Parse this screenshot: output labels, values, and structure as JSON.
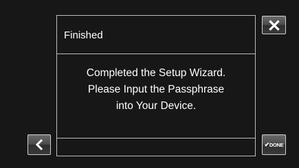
{
  "dialog": {
    "title": "Finished",
    "message_lines": [
      "Completed the Setup Wizard.",
      "Please Input the Passphrase",
      "into Your Device."
    ]
  },
  "buttons": {
    "close": {
      "icon": "close-icon"
    },
    "back": {
      "icon": "chevron-left-icon"
    },
    "done": {
      "icon": "checkmark-icon",
      "check_glyph": "✔",
      "label": "DONE"
    }
  },
  "colors": {
    "background": "#171717",
    "frame": "#bdbdbd",
    "text": "#ffffff"
  }
}
